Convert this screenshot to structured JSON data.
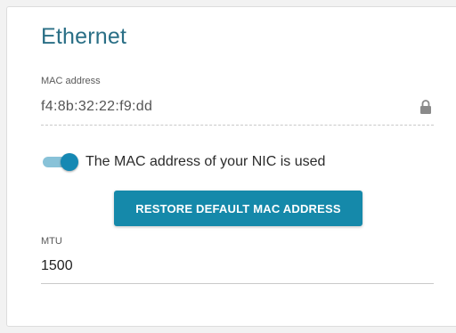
{
  "section": {
    "title": "Ethernet"
  },
  "mac": {
    "label": "MAC address",
    "value": "f4:8b:32:22:f9:dd",
    "locked_icon": "lock-icon"
  },
  "nic_toggle": {
    "label": "The MAC address of your NIC is used",
    "enabled": true
  },
  "restore_button": {
    "label": "RESTORE DEFAULT MAC ADDRESS"
  },
  "mtu": {
    "label": "MTU",
    "value": "1500"
  },
  "colors": {
    "accent": "#1589aa",
    "title": "#2a6f86",
    "toggle_knob": "#1588b3",
    "toggle_track": "#88c2d8"
  }
}
